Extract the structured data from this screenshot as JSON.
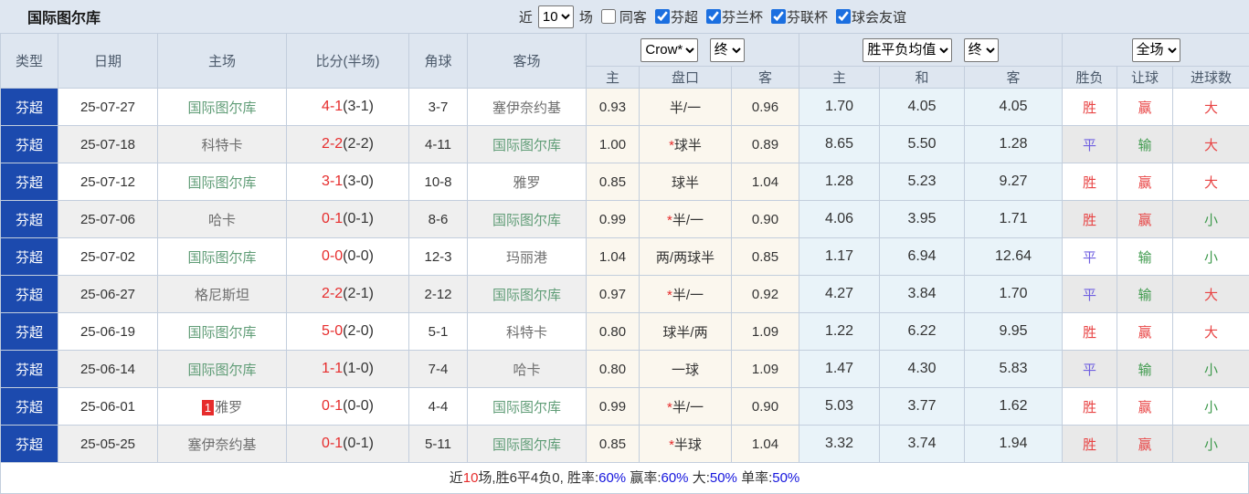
{
  "title": "国际图尔库",
  "colors": {
    "league_badge_blue": "#1c4aae",
    "self_team_green": "#5f9c76",
    "score_red": "#e62c2c",
    "result_win_red": "#e84444",
    "result_draw_blue": "#6f5fe0",
    "result_lose_green": "#3f9a4d",
    "stat_link_blue": "#1414dd",
    "header_bg": "#dee6f0",
    "odds_bg": "#fbf7ee",
    "avg_bg": "#e9f3f9"
  },
  "topbar": {
    "recent_label": "近",
    "recent_value": "10",
    "games_label": "场",
    "same_venue_label": "同客",
    "filters": [
      "芬超",
      "芬兰杯",
      "芬联杯",
      "球会友谊"
    ]
  },
  "header": {
    "columns": {
      "type": "类型",
      "date": "日期",
      "home": "主场",
      "score": "比分(半场)",
      "corner": "角球",
      "away": "客场"
    },
    "odds_group": {
      "bookmaker": "Crow*",
      "stage": "终",
      "sub": {
        "home": "主",
        "handicap": "盘口",
        "away": "客"
      }
    },
    "avg_group": {
      "label": "胜平负均值",
      "stage": "终",
      "sub": {
        "win": "主",
        "draw": "和",
        "lose": "客"
      }
    },
    "result_group": {
      "scope": "全场",
      "sub": {
        "result": "胜负",
        "handicap": "让球",
        "goals": "进球数"
      }
    }
  },
  "rows": [
    {
      "league": "芬超",
      "date": "25-07-27",
      "home": {
        "name": "国际图尔库",
        "self": true,
        "badge": ""
      },
      "score": {
        "full": "4-1",
        "half": "(3-1)"
      },
      "corner": "3-7",
      "away": {
        "name": "塞伊奈约基",
        "self": false
      },
      "odds": {
        "home": "0.93",
        "star": "",
        "handicap": "半/一",
        "away": "0.96"
      },
      "avg": {
        "win": "1.70",
        "draw": "4.05",
        "lose": "4.05"
      },
      "result": {
        "text": "胜",
        "cls": "win"
      },
      "handicap_result": {
        "text": "赢",
        "cls": "win"
      },
      "goals": {
        "text": "大",
        "cls": "big"
      }
    },
    {
      "league": "芬超",
      "date": "25-07-18",
      "home": {
        "name": "科特卡",
        "self": false,
        "badge": ""
      },
      "score": {
        "full": "2-2",
        "half": "(2-2)"
      },
      "corner": "4-11",
      "away": {
        "name": "国际图尔库",
        "self": true
      },
      "odds": {
        "home": "1.00",
        "star": "*",
        "handicap": "球半",
        "away": "0.89"
      },
      "avg": {
        "win": "8.65",
        "draw": "5.50",
        "lose": "1.28"
      },
      "result": {
        "text": "平",
        "cls": "draw"
      },
      "handicap_result": {
        "text": "输",
        "cls": "lose"
      },
      "goals": {
        "text": "大",
        "cls": "big"
      }
    },
    {
      "league": "芬超",
      "date": "25-07-12",
      "home": {
        "name": "国际图尔库",
        "self": true,
        "badge": ""
      },
      "score": {
        "full": "3-1",
        "half": "(3-0)"
      },
      "corner": "10-8",
      "away": {
        "name": "雅罗",
        "self": false
      },
      "odds": {
        "home": "0.85",
        "star": "",
        "handicap": "球半",
        "away": "1.04"
      },
      "avg": {
        "win": "1.28",
        "draw": "5.23",
        "lose": "9.27"
      },
      "result": {
        "text": "胜",
        "cls": "win"
      },
      "handicap_result": {
        "text": "赢",
        "cls": "win"
      },
      "goals": {
        "text": "大",
        "cls": "big"
      }
    },
    {
      "league": "芬超",
      "date": "25-07-06",
      "home": {
        "name": "哈卡",
        "self": false,
        "badge": ""
      },
      "score": {
        "full": "0-1",
        "half": "(0-1)"
      },
      "corner": "8-6",
      "away": {
        "name": "国际图尔库",
        "self": true
      },
      "odds": {
        "home": "0.99",
        "star": "*",
        "handicap": "半/一",
        "away": "0.90"
      },
      "avg": {
        "win": "4.06",
        "draw": "3.95",
        "lose": "1.71"
      },
      "result": {
        "text": "胜",
        "cls": "win"
      },
      "handicap_result": {
        "text": "赢",
        "cls": "win"
      },
      "goals": {
        "text": "小",
        "cls": "small"
      }
    },
    {
      "league": "芬超",
      "date": "25-07-02",
      "home": {
        "name": "国际图尔库",
        "self": true,
        "badge": ""
      },
      "score": {
        "full": "0-0",
        "half": "(0-0)"
      },
      "corner": "12-3",
      "away": {
        "name": "玛丽港",
        "self": false
      },
      "odds": {
        "home": "1.04",
        "star": "",
        "handicap": "两/两球半",
        "away": "0.85"
      },
      "avg": {
        "win": "1.17",
        "draw": "6.94",
        "lose": "12.64"
      },
      "result": {
        "text": "平",
        "cls": "draw"
      },
      "handicap_result": {
        "text": "输",
        "cls": "lose"
      },
      "goals": {
        "text": "小",
        "cls": "small"
      }
    },
    {
      "league": "芬超",
      "date": "25-06-27",
      "home": {
        "name": "格尼斯坦",
        "self": false,
        "badge": ""
      },
      "score": {
        "full": "2-2",
        "half": "(2-1)"
      },
      "corner": "2-12",
      "away": {
        "name": "国际图尔库",
        "self": true
      },
      "odds": {
        "home": "0.97",
        "star": "*",
        "handicap": "半/一",
        "away": "0.92"
      },
      "avg": {
        "win": "4.27",
        "draw": "3.84",
        "lose": "1.70"
      },
      "result": {
        "text": "平",
        "cls": "draw"
      },
      "handicap_result": {
        "text": "输",
        "cls": "lose"
      },
      "goals": {
        "text": "大",
        "cls": "big"
      }
    },
    {
      "league": "芬超",
      "date": "25-06-19",
      "home": {
        "name": "国际图尔库",
        "self": true,
        "badge": ""
      },
      "score": {
        "full": "5-0",
        "half": "(2-0)"
      },
      "corner": "5-1",
      "away": {
        "name": "科特卡",
        "self": false
      },
      "odds": {
        "home": "0.80",
        "star": "",
        "handicap": "球半/两",
        "away": "1.09"
      },
      "avg": {
        "win": "1.22",
        "draw": "6.22",
        "lose": "9.95"
      },
      "result": {
        "text": "胜",
        "cls": "win"
      },
      "handicap_result": {
        "text": "赢",
        "cls": "win"
      },
      "goals": {
        "text": "大",
        "cls": "big"
      }
    },
    {
      "league": "芬超",
      "date": "25-06-14",
      "home": {
        "name": "国际图尔库",
        "self": true,
        "badge": ""
      },
      "score": {
        "full": "1-1",
        "half": "(1-0)"
      },
      "corner": "7-4",
      "away": {
        "name": "哈卡",
        "self": false
      },
      "odds": {
        "home": "0.80",
        "star": "",
        "handicap": "一球",
        "away": "1.09"
      },
      "avg": {
        "win": "1.47",
        "draw": "4.30",
        "lose": "5.83"
      },
      "result": {
        "text": "平",
        "cls": "draw"
      },
      "handicap_result": {
        "text": "输",
        "cls": "lose"
      },
      "goals": {
        "text": "小",
        "cls": "small"
      }
    },
    {
      "league": "芬超",
      "date": "25-06-01",
      "home": {
        "name": "雅罗",
        "self": false,
        "badge": "1"
      },
      "score": {
        "full": "0-1",
        "half": "(0-0)"
      },
      "corner": "4-4",
      "away": {
        "name": "国际图尔库",
        "self": true
      },
      "odds": {
        "home": "0.99",
        "star": "*",
        "handicap": "半/一",
        "away": "0.90"
      },
      "avg": {
        "win": "5.03",
        "draw": "3.77",
        "lose": "1.62"
      },
      "result": {
        "text": "胜",
        "cls": "win"
      },
      "handicap_result": {
        "text": "赢",
        "cls": "win"
      },
      "goals": {
        "text": "小",
        "cls": "small"
      }
    },
    {
      "league": "芬超",
      "date": "25-05-25",
      "home": {
        "name": "塞伊奈约基",
        "self": false,
        "badge": ""
      },
      "score": {
        "full": "0-1",
        "half": "(0-1)"
      },
      "corner": "5-11",
      "away": {
        "name": "国际图尔库",
        "self": true
      },
      "odds": {
        "home": "0.85",
        "star": "*",
        "handicap": "半球",
        "away": "1.04"
      },
      "avg": {
        "win": "3.32",
        "draw": "3.74",
        "lose": "1.94"
      },
      "result": {
        "text": "胜",
        "cls": "win"
      },
      "handicap_result": {
        "text": "赢",
        "cls": "win"
      },
      "goals": {
        "text": "小",
        "cls": "small"
      }
    }
  ],
  "footer": {
    "segments": [
      {
        "t": "近",
        "c": "dark"
      },
      {
        "t": "10",
        "c": "red"
      },
      {
        "t": "场,胜6平4负0, 胜率:",
        "c": "dark"
      },
      {
        "t": "60%",
        "c": "blue"
      },
      {
        "t": " 赢率:",
        "c": "dark"
      },
      {
        "t": "60%",
        "c": "blue"
      },
      {
        "t": " 大:",
        "c": "dark"
      },
      {
        "t": "50%",
        "c": "blue"
      },
      {
        "t": " 单率:",
        "c": "dark"
      },
      {
        "t": "50%",
        "c": "blue"
      }
    ]
  }
}
